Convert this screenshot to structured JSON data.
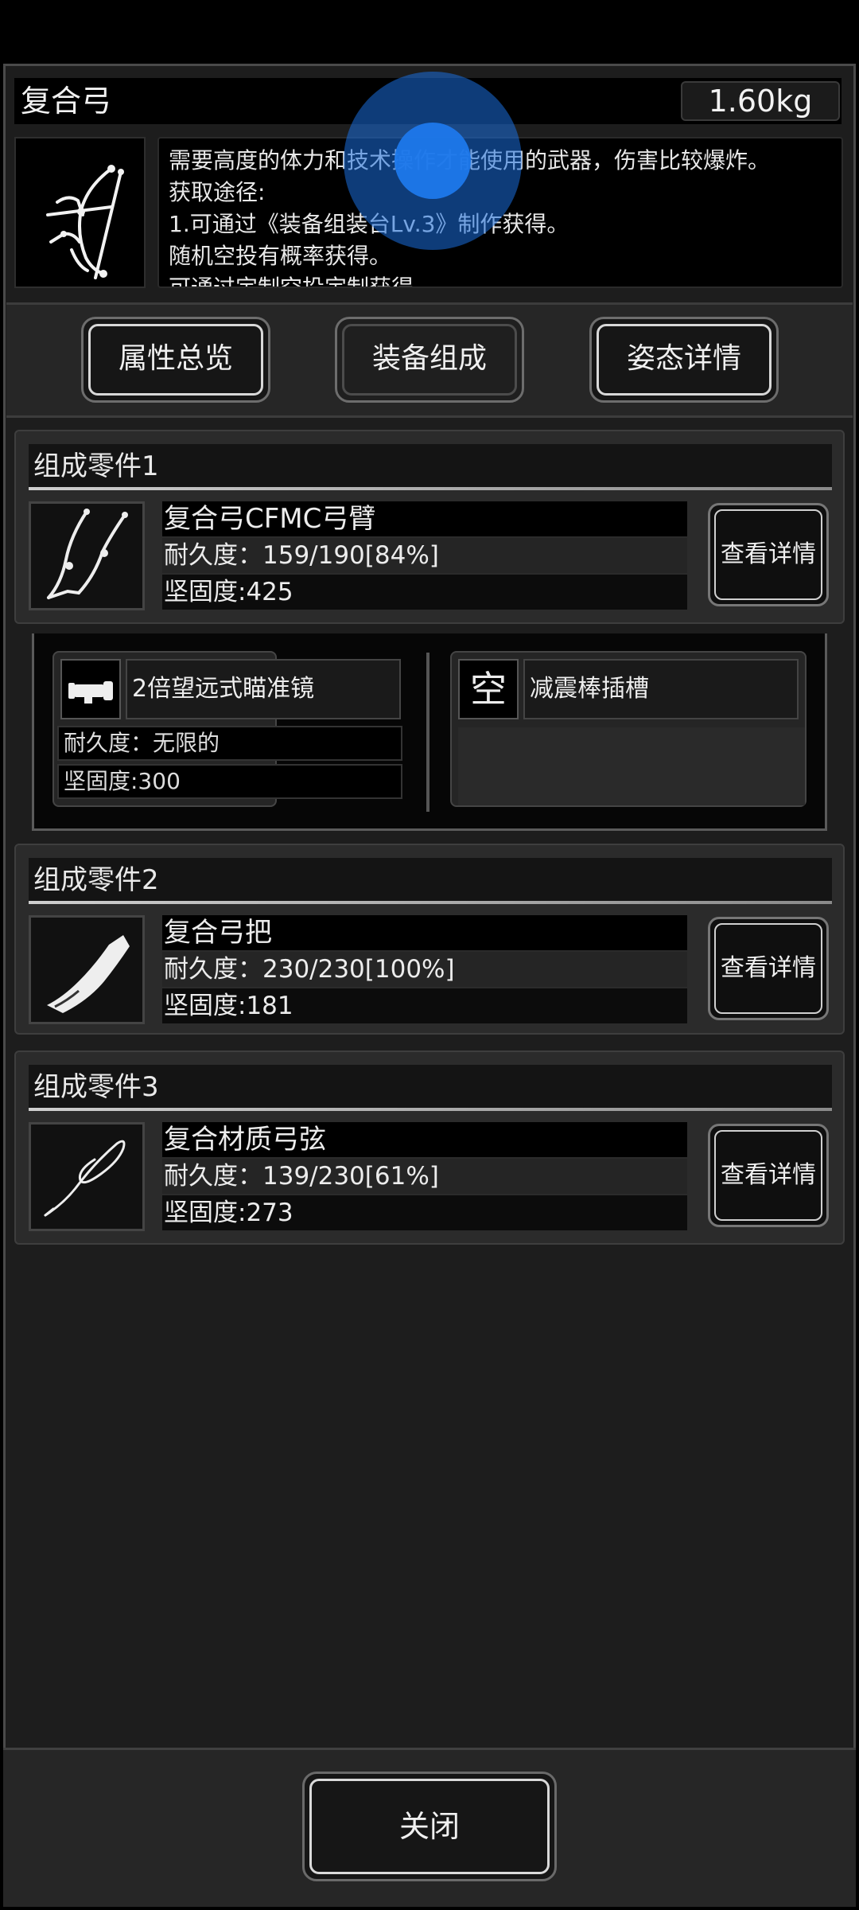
{
  "header": {
    "title": "复合弓",
    "weight": "1.60kg"
  },
  "description": {
    "lines": [
      "需要高度的体力和技术操作才能使用的武器，伤害比较爆炸。",
      "获取途径:",
      "1.可通过《装备组装台Lv.3》制作获得。",
      "随机空投有概率获得。",
      "可通过定制空投定制获得"
    ]
  },
  "tabs": [
    {
      "label": "属性总览",
      "active": false
    },
    {
      "label": "装备组成",
      "active": true
    },
    {
      "label": "姿态详情",
      "active": false
    }
  ],
  "parts": [
    {
      "header": "组成零件1",
      "name": "复合弓CFMC弓臂",
      "durability": "耐久度：159/190[84%]",
      "hardness": "坚固度:425",
      "button": "查看详情",
      "icon": "bow-limb-icon"
    },
    {
      "header": "组成零件2",
      "name": "复合弓把",
      "durability": "耐久度：230/230[100%]",
      "hardness": "坚固度:181",
      "button": "查看详情",
      "icon": "bow-grip-icon"
    },
    {
      "header": "组成零件3",
      "name": "复合材质弓弦",
      "durability": "耐久度：139/230[61%]",
      "hardness": "坚固度:273",
      "button": "查看详情",
      "icon": "bowstring-icon"
    }
  ],
  "attachments": {
    "slot1": {
      "name": "2倍望远式瞄准镜",
      "durability": "耐久度：无限的",
      "hardness": "坚固度:300",
      "icon": "scope-icon"
    },
    "slot2": {
      "empty_glyph": "空",
      "name": "减震棒插槽"
    }
  },
  "footer": {
    "close_label": "关闭"
  },
  "colors": {
    "background": "#1d1d1d",
    "touch_indicator": "#1e78eb"
  }
}
